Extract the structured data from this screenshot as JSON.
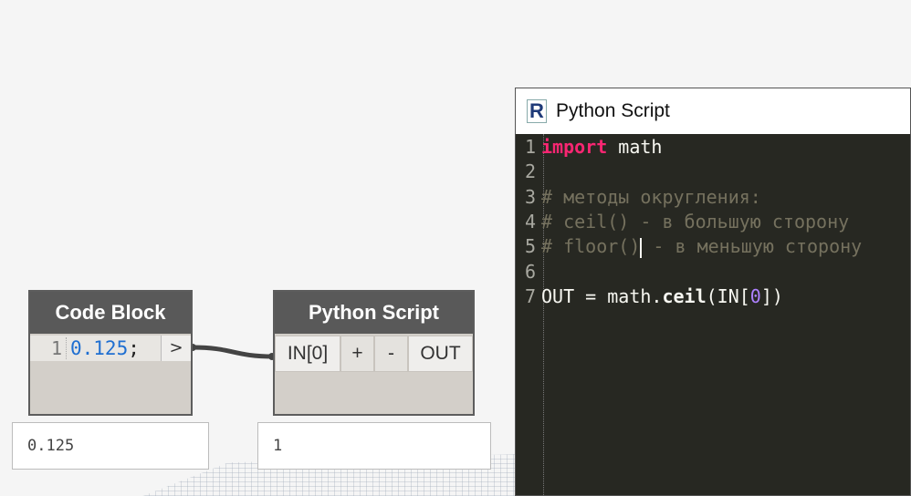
{
  "code_block_node": {
    "title": "Code Block",
    "line_number": "1",
    "code_value": "0.125",
    "code_suffix": ";",
    "output_arrow": ">",
    "preview_value": "0.125"
  },
  "python_node": {
    "title": "Python Script",
    "input_port": "IN[0]",
    "add_input": "+",
    "remove_input": "-",
    "output_port": "OUT",
    "preview_value": "1"
  },
  "editor": {
    "window_title": "Python Script",
    "app_icon_letter": "R",
    "lines": [
      {
        "num": "1",
        "kw": "import",
        "rest": " math"
      },
      {
        "num": "2"
      },
      {
        "num": "3",
        "comment": "# методы округления:"
      },
      {
        "num": "4",
        "comment": "# ceil() - в большую сторону"
      },
      {
        "num": "5",
        "comment_a": "# floor()",
        "comment_b": " - в меньшую сторону"
      },
      {
        "num": "6"
      },
      {
        "num": "7",
        "p1": "OUT = math.",
        "fn": "ceil",
        "p2": "(IN[",
        "idx": "0",
        "p3": "])"
      }
    ]
  },
  "colors": {
    "editor_bg": "#272822",
    "keyword": "#f92672",
    "comment": "#75715e",
    "number": "#ae81ff",
    "code_block_number": "#1f6fd1",
    "node_header": "#595959"
  }
}
